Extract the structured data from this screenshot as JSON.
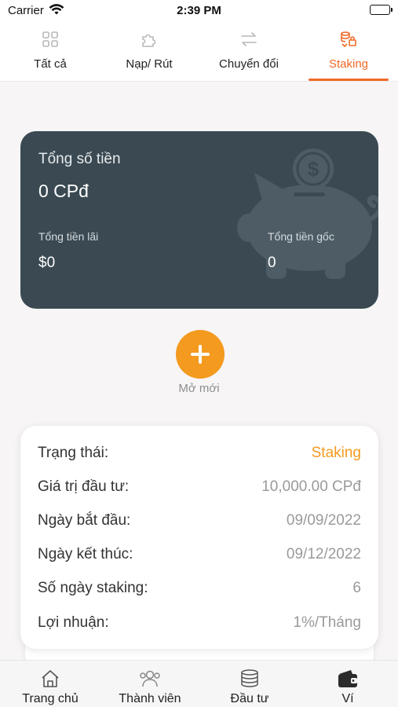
{
  "status_bar": {
    "carrier": "Carrier",
    "time": "2:39 PM"
  },
  "top_tabs": [
    {
      "label": "Tất cả",
      "icon": "grid-icon",
      "active": false
    },
    {
      "label": "Nạp/ Rút",
      "icon": "puzzle-icon",
      "active": false
    },
    {
      "label": "Chuyển đổi",
      "icon": "swap-arrows-icon",
      "active": false
    },
    {
      "label": "Staking",
      "icon": "staking-icon",
      "active": true
    }
  ],
  "summary": {
    "title": "Tổng số tiền",
    "amount": "0 CPđ",
    "interest_label": "Tổng tiền lãi",
    "interest_value": "$0",
    "principal_label": "Tổng tiền gốc",
    "principal_value": "0",
    "background_icon": "piggy-bank-icon"
  },
  "add_new": {
    "label": "Mở mới",
    "icon": "plus-icon"
  },
  "staking_detail": {
    "rows": [
      {
        "label": "Trạng thái:",
        "value": "Staking"
      },
      {
        "label": "Giá trị đầu tư:",
        "value": "10,000.00 CPđ"
      },
      {
        "label": "Ngày bắt đầu:",
        "value": "09/09/2022"
      },
      {
        "label": "Ngày kết thúc:",
        "value": "09/12/2022"
      },
      {
        "label": "Số ngày staking:",
        "value": "6"
      },
      {
        "label": "Lợi nhuận:",
        "value": "1%/Tháng"
      }
    ]
  },
  "bottom_nav": [
    {
      "label": "Trang chủ",
      "icon": "home-icon"
    },
    {
      "label": "Thành viên",
      "icon": "members-icon"
    },
    {
      "label": "Đầu tư",
      "icon": "coins-stack-icon"
    },
    {
      "label": "Ví",
      "icon": "wallet-icon"
    }
  ],
  "colors": {
    "accent": "#f06a28",
    "button": "#f39a1f",
    "card_dark": "#3b4a52"
  }
}
